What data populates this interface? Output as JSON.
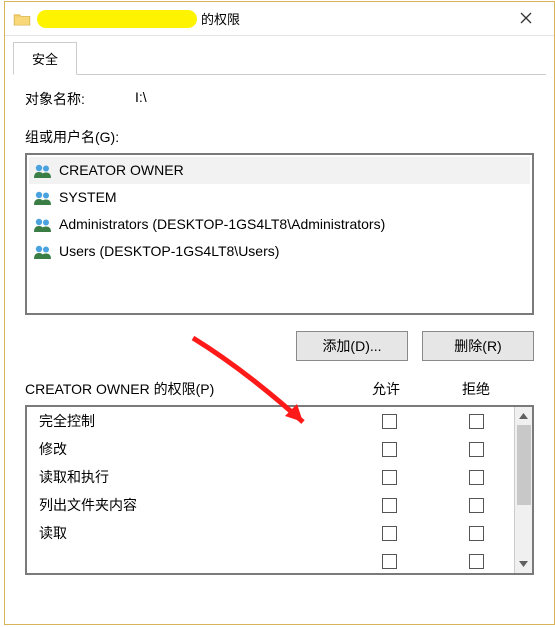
{
  "title_suffix": "的权限",
  "tabs": {
    "security": "安全"
  },
  "object_name_label": "对象名称:",
  "object_name_value": "I:\\",
  "group_users_label": "组或用户名(G):",
  "users": [
    {
      "name": "CREATOR OWNER",
      "selected": true
    },
    {
      "name": "SYSTEM",
      "selected": false
    },
    {
      "name": "Administrators (DESKTOP-1GS4LT8\\Administrators)",
      "selected": false
    },
    {
      "name": "Users (DESKTOP-1GS4LT8\\Users)",
      "selected": false
    }
  ],
  "buttons": {
    "add": "添加(D)...",
    "remove": "删除(R)"
  },
  "perm_header_for": "CREATOR OWNER 的权限(P)",
  "col_allow": "允许",
  "col_deny": "拒绝",
  "permissions": [
    {
      "label": "完全控制"
    },
    {
      "label": "修改"
    },
    {
      "label": "读取和执行"
    },
    {
      "label": "列出文件夹内容"
    },
    {
      "label": "读取"
    },
    {
      "label": ""
    }
  ]
}
